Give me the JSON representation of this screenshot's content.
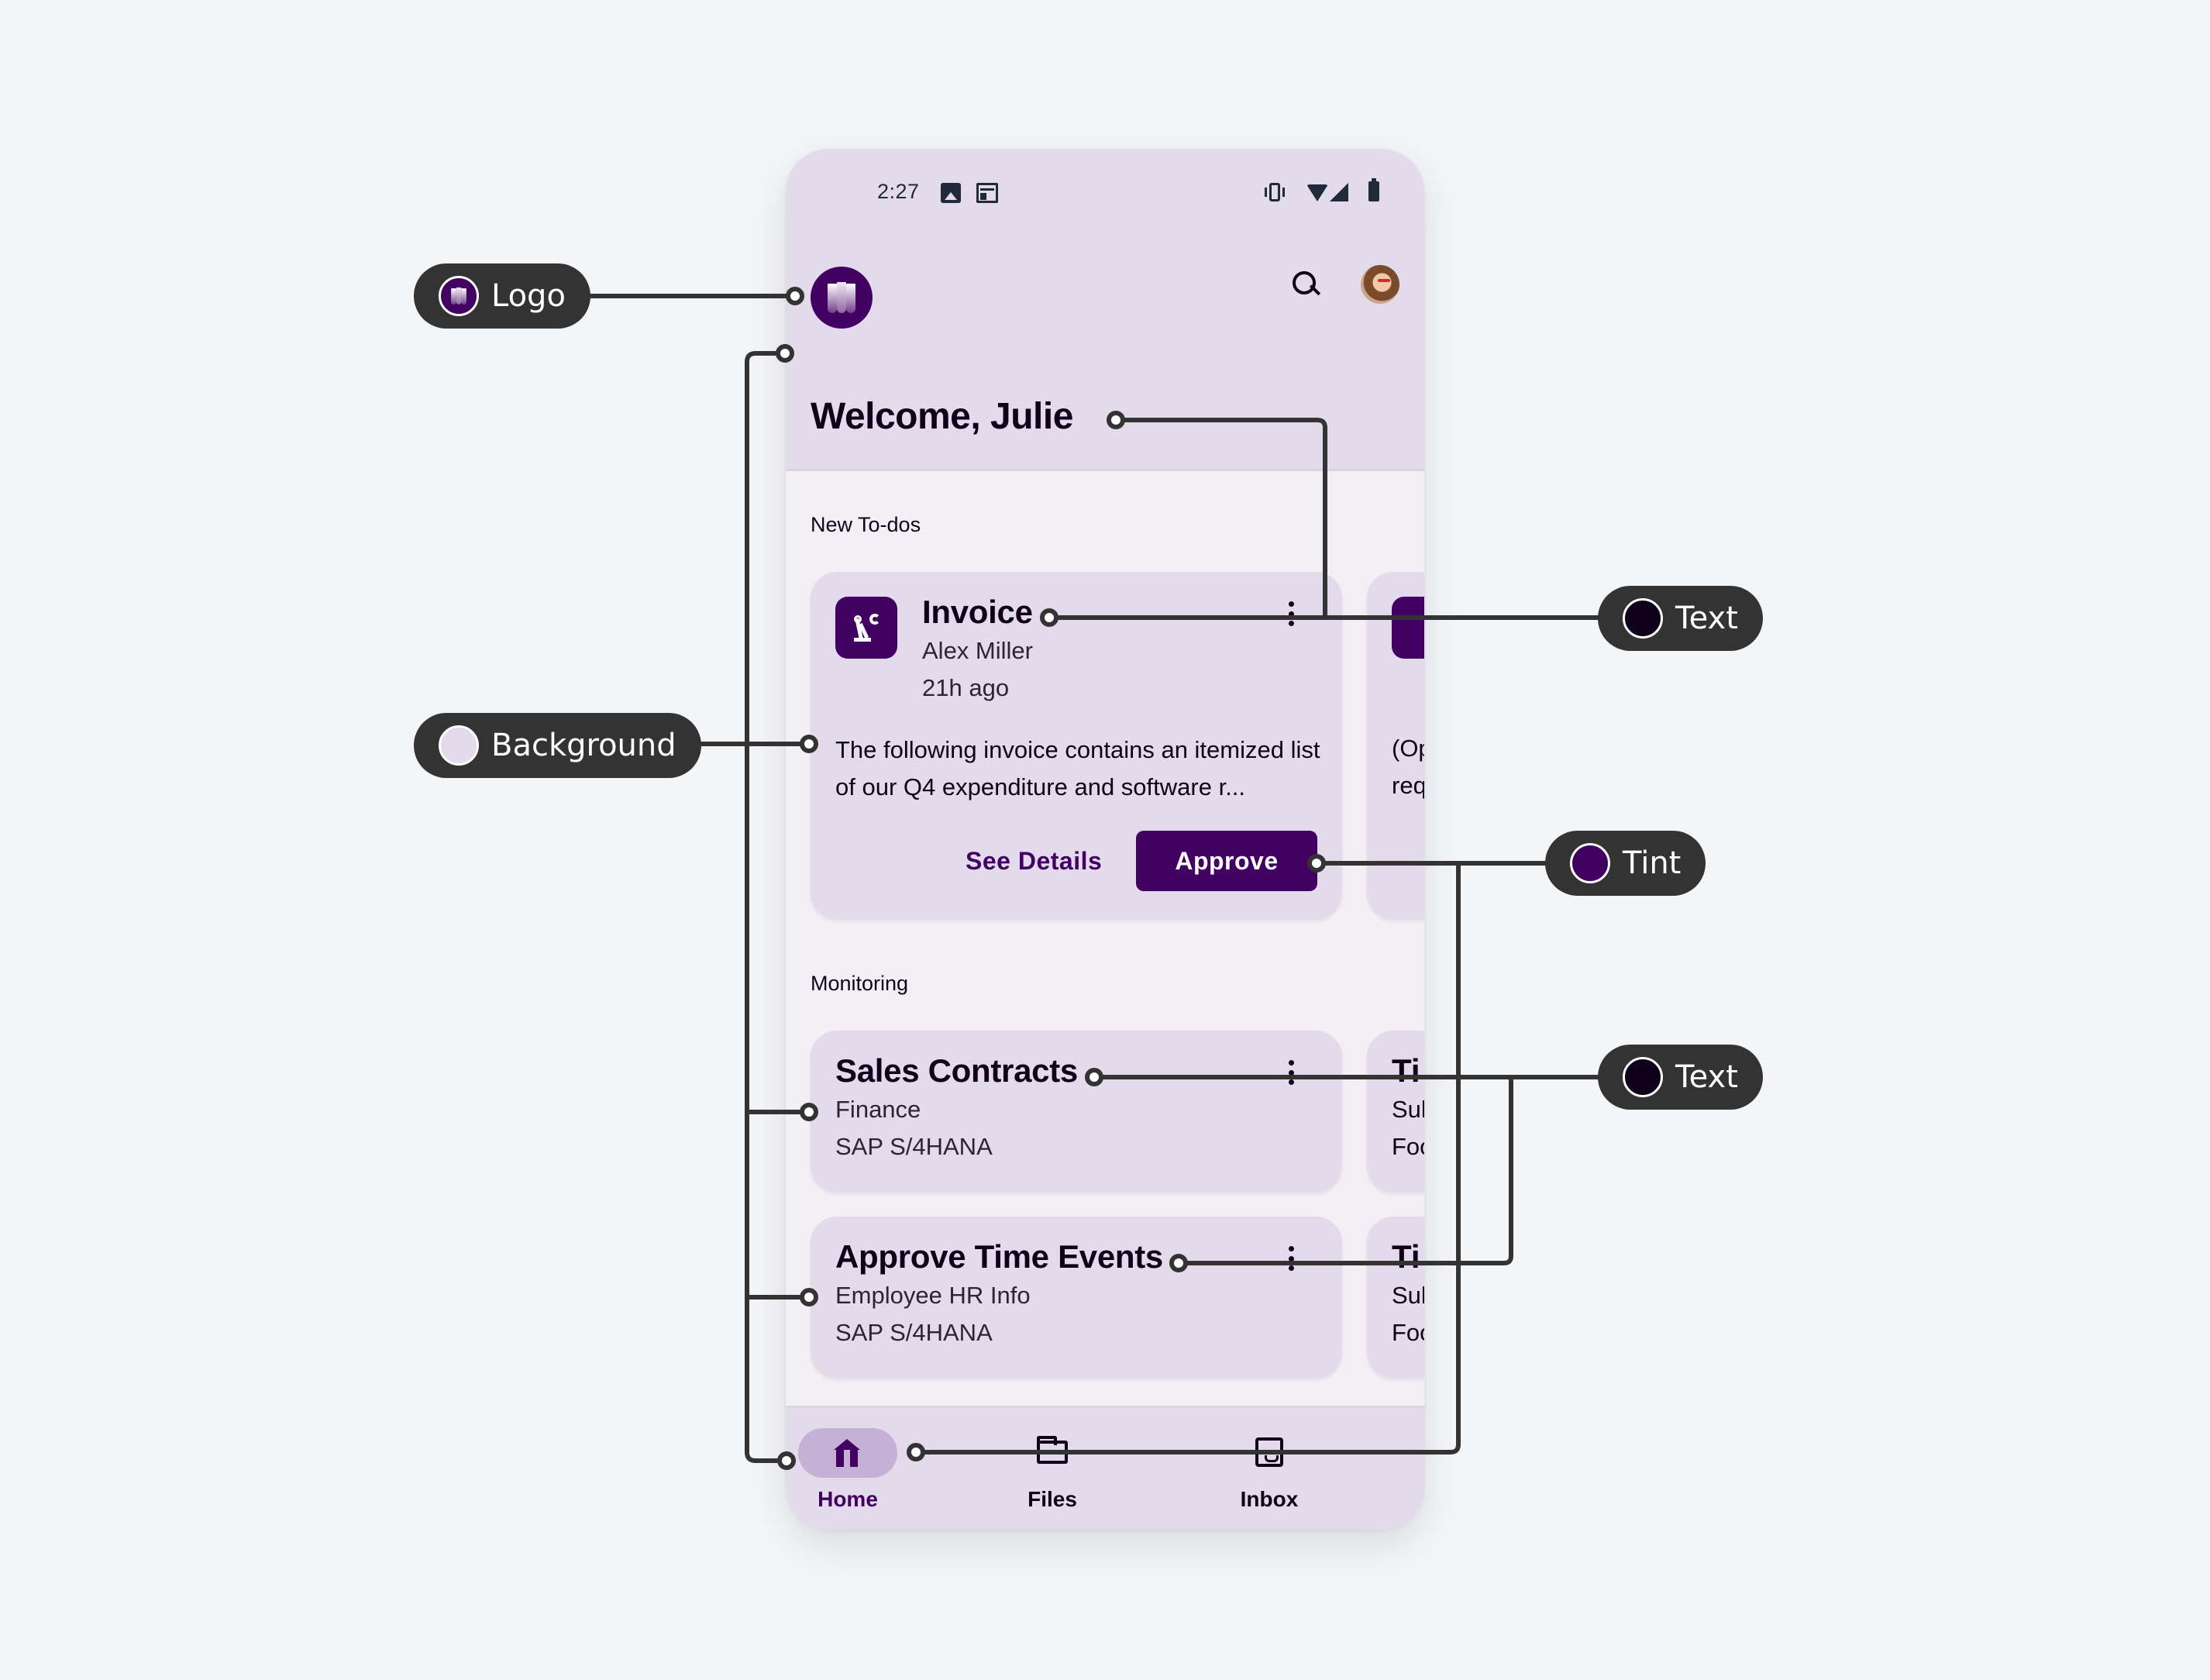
{
  "status_bar": {
    "time": "2:27",
    "left_icons": [
      "image-icon",
      "news-icon"
    ],
    "right_icons": [
      "vibrate-icon",
      "wifi-icon",
      "signal-icon",
      "battery-icon"
    ]
  },
  "header": {
    "logo_icon": "app-logo-icon",
    "search_icon": "search-icon",
    "avatar": "user-avatar",
    "welcome": "Welcome, Julie"
  },
  "sections": {
    "todos_label": "New To-dos",
    "monitoring_label": "Monitoring"
  },
  "todo_card": {
    "icon": "robot-arm-icon",
    "title": "Invoice",
    "subtitle": "Alex Miller",
    "time": "21h ago",
    "body": "The following invoice contains an itemized list of our Q4 expenditure and software r...",
    "secondary_action": "See Details",
    "primary_action": "Approve"
  },
  "todo_card_peek": {
    "body_line1": "(Op",
    "body_line2": "req"
  },
  "monitoring_cards": [
    {
      "title": "Sales Contracts",
      "subtitle": "Finance",
      "system": "SAP S/4HANA"
    },
    {
      "title": "Approve Time Events",
      "subtitle": "Employee HR Info",
      "system": "SAP S/4HANA"
    }
  ],
  "monitoring_peeks": [
    {
      "title": "Ti",
      "line1": "Sul",
      "line2": "Foo"
    },
    {
      "title": "Ti",
      "line1": "Sul",
      "line2": "Foo"
    }
  ],
  "bottom_nav": [
    {
      "label": "Home",
      "icon": "home-icon",
      "active": true
    },
    {
      "label": "Files",
      "icon": "folder-icon",
      "active": false
    },
    {
      "label": "Inbox",
      "icon": "inbox-icon",
      "active": false
    }
  ],
  "annotations": {
    "logo": {
      "label": "Logo"
    },
    "background": {
      "label": "Background",
      "color": "#e3daec"
    },
    "text_top": {
      "label": "Text",
      "color": "#11001a"
    },
    "tint": {
      "label": "Tint",
      "color": "#420063"
    },
    "text_bottom": {
      "label": "Text",
      "color": "#11001a"
    }
  }
}
